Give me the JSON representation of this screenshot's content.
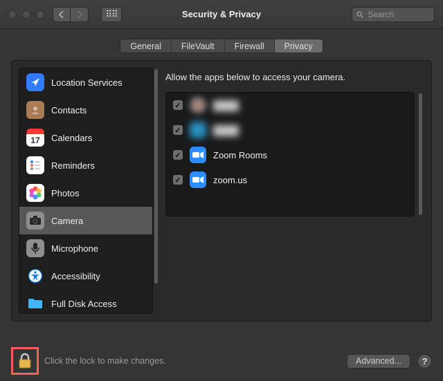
{
  "window": {
    "title": "Security & Privacy",
    "search_placeholder": "Search"
  },
  "tabs": {
    "items": [
      {
        "label": "General",
        "active": false
      },
      {
        "label": "FileVault",
        "active": false
      },
      {
        "label": "Firewall",
        "active": false
      },
      {
        "label": "Privacy",
        "active": true
      }
    ]
  },
  "sidebar": {
    "items": [
      {
        "id": "location",
        "label": "Location Services",
        "icon": "location-arrow",
        "bg": "#2f7cf6",
        "selected": false
      },
      {
        "id": "contacts",
        "label": "Contacts",
        "icon": "contacts",
        "bg": "#a97c55",
        "selected": false
      },
      {
        "id": "calendars",
        "label": "Calendars",
        "icon": "calendar",
        "bg": "#ffffff",
        "selected": false
      },
      {
        "id": "reminders",
        "label": "Reminders",
        "icon": "reminders",
        "bg": "#ffffff",
        "selected": false
      },
      {
        "id": "photos",
        "label": "Photos",
        "icon": "photos",
        "bg": "#ffffff",
        "selected": false
      },
      {
        "id": "camera",
        "label": "Camera",
        "icon": "camera",
        "bg": "#8e8e8e",
        "selected": true
      },
      {
        "id": "microphone",
        "label": "Microphone",
        "icon": "microphone",
        "bg": "#8e8e8e",
        "selected": false
      },
      {
        "id": "a11y",
        "label": "Accessibility",
        "icon": "accessibility",
        "bg": "#0a84ff",
        "selected": false
      },
      {
        "id": "fda",
        "label": "Full Disk Access",
        "icon": "folder",
        "bg": "#3fb6ff",
        "selected": false
      }
    ]
  },
  "panel": {
    "description": "Allow the apps below to access your camera.",
    "apps": [
      {
        "name": "",
        "checked": true,
        "blurred": true,
        "icon_bg_1": "#e05050",
        "icon_bg_2": "#3aa757"
      },
      {
        "name": "",
        "checked": true,
        "blurred": true,
        "icon_bg_1": "#2aa6e0"
      },
      {
        "name": "Zoom Rooms",
        "checked": true,
        "blurred": false,
        "icon_bg_1": "#2d8cff"
      },
      {
        "name": "zoom.us",
        "checked": true,
        "blurred": false,
        "icon_bg_1": "#2d8cff"
      }
    ]
  },
  "footer": {
    "lock_text": "Click the lock to make changes.",
    "advanced_label": "Advanced...",
    "help_label": "?"
  }
}
